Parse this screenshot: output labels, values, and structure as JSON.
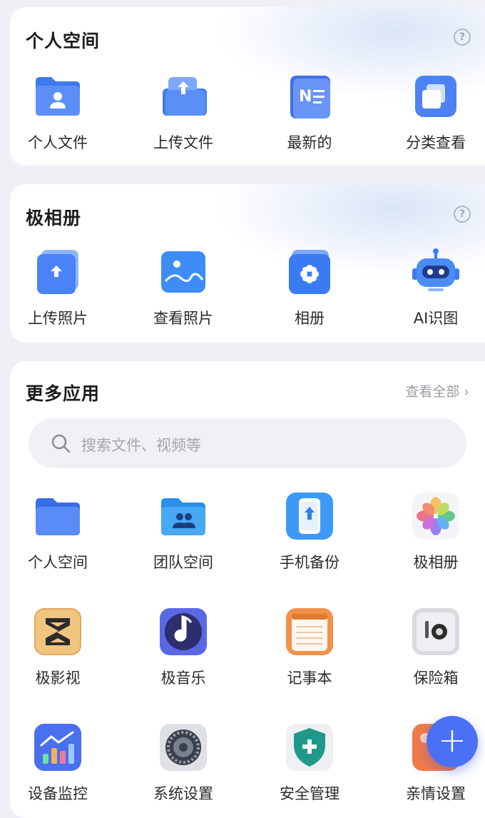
{
  "personal_space": {
    "title": "个人空间",
    "help": "?",
    "items": [
      {
        "label": "个人文件",
        "icon": "personal-files-icon"
      },
      {
        "label": "上传文件",
        "icon": "upload-file-icon"
      },
      {
        "label": "最新的",
        "icon": "recent-notes-icon"
      },
      {
        "label": "分类查看",
        "icon": "category-view-icon"
      }
    ]
  },
  "album": {
    "title": "极相册",
    "help": "?",
    "items": [
      {
        "label": "上传照片",
        "icon": "upload-photo-icon"
      },
      {
        "label": "查看照片",
        "icon": "view-photos-icon"
      },
      {
        "label": "相册",
        "icon": "album-icon"
      },
      {
        "label": "AI识图",
        "icon": "ai-robot-icon"
      }
    ]
  },
  "more_apps": {
    "title": "更多应用",
    "view_all": "查看全部",
    "search_placeholder": "搜索文件、视频等",
    "apps": [
      {
        "label": "个人空间",
        "icon": "personal-space-folder-icon"
      },
      {
        "label": "团队空间",
        "icon": "team-space-folder-icon"
      },
      {
        "label": "手机备份",
        "icon": "phone-backup-icon"
      },
      {
        "label": "极相册",
        "icon": "photo-album-flower-icon"
      },
      {
        "label": "极影视",
        "icon": "video-app-icon"
      },
      {
        "label": "极音乐",
        "icon": "music-note-icon"
      },
      {
        "label": "记事本",
        "icon": "notepad-icon"
      },
      {
        "label": "保险箱",
        "icon": "safe-box-icon"
      },
      {
        "label": "设备监控",
        "icon": "device-monitor-chart-icon"
      },
      {
        "label": "系统设置",
        "icon": "system-settings-gear-icon"
      },
      {
        "label": "安全管理",
        "icon": "security-shield-icon"
      },
      {
        "label": "亲情设置",
        "icon": "family-settings-icon"
      }
    ]
  },
  "fab": {
    "label": "+",
    "icon": "add-icon"
  },
  "colors": {
    "accent": "#4a71f5",
    "background": "#eef0f6"
  }
}
